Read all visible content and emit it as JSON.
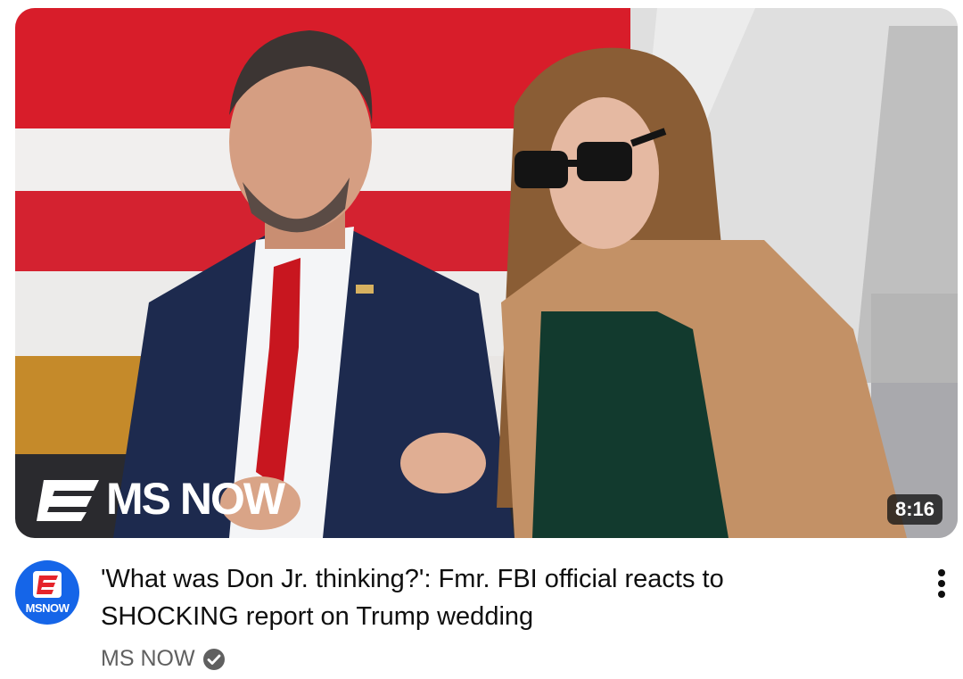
{
  "video": {
    "duration": "8:16",
    "title": "'What was Don Jr. thinking?': Fmr. FBI official reacts to SHOCKING report on Trump wedding",
    "brand_watermark": "MS NOW"
  },
  "channel": {
    "name": "MS NOW",
    "avatar_text": "MSNOW",
    "verified": true,
    "verified_icon": "verified-check-icon"
  },
  "colors": {
    "brand_blue": "#1565e8",
    "text_primary": "#0f0f0f",
    "text_secondary": "#606060"
  },
  "icons": {
    "menu": "more-vert-icon",
    "brand_mark": "ms-now-logo-icon"
  }
}
